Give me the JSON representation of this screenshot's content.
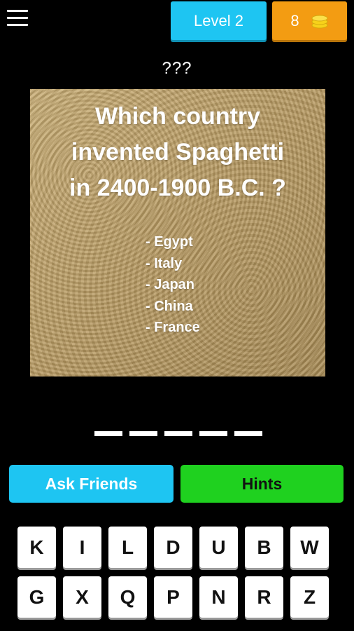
{
  "header": {
    "level_label": "Level 2",
    "coins": "8"
  },
  "answer_placeholder": "???",
  "question": {
    "lines": [
      "Which country",
      "invented Spaghetti",
      "in 2400-1900 B.C. ?"
    ],
    "options": [
      "- Egypt",
      "- Italy",
      "- Japan",
      "- China",
      "- France"
    ]
  },
  "answer_slots": 5,
  "buttons": {
    "ask_friends": "Ask Friends",
    "hints": "Hints"
  },
  "keyboard": {
    "row1": [
      "K",
      "I",
      "L",
      "D",
      "U",
      "B",
      "W"
    ],
    "row2": [
      "G",
      "X",
      "Q",
      "P",
      "N",
      "R",
      "Z"
    ]
  },
  "colors": {
    "level_badge": "#1ec5f2",
    "coins_badge": "#f39c12",
    "ask_button": "#1ec5f2",
    "hints_button": "#1fd11f"
  }
}
